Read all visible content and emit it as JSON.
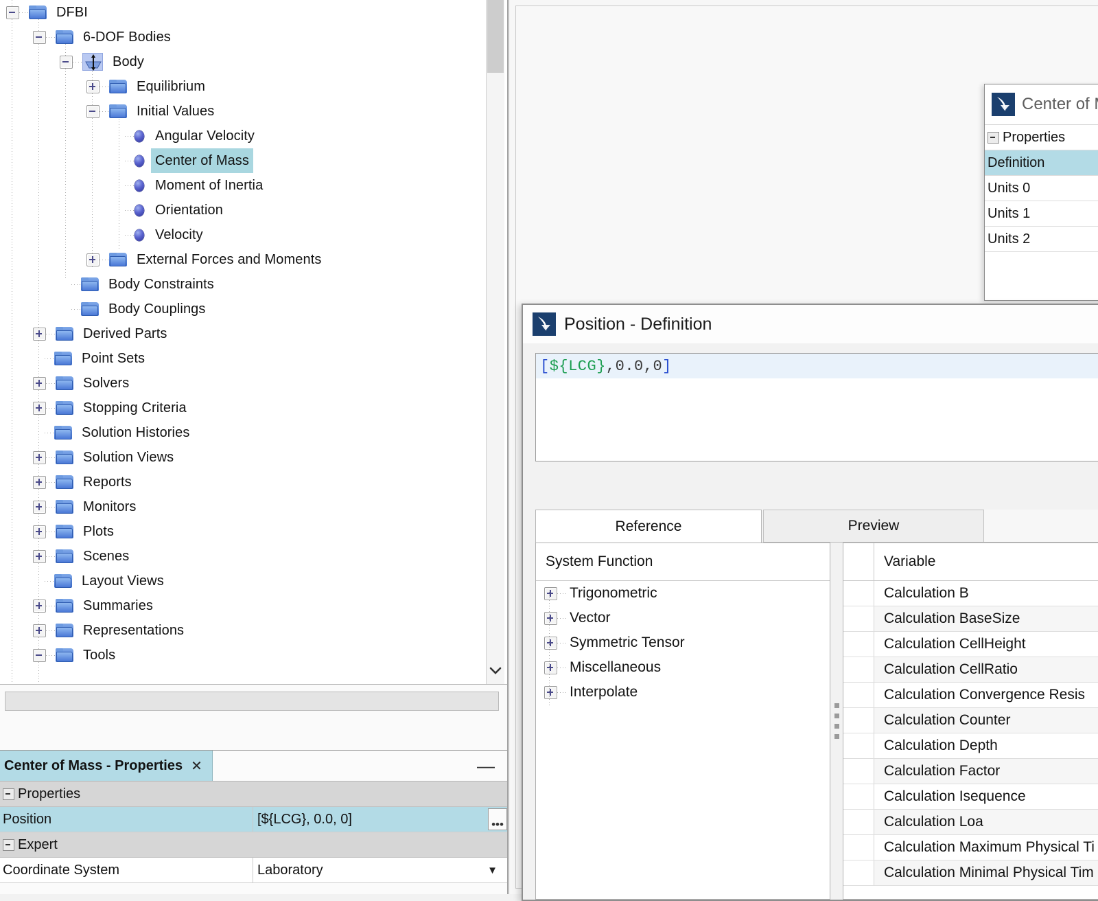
{
  "tree": {
    "nodes": [
      {
        "label": "DFBI",
        "indent": 0,
        "toggle": "minus",
        "icon": "folder"
      },
      {
        "label": "6-DOF Bodies",
        "indent": 1,
        "toggle": "minus",
        "icon": "folder"
      },
      {
        "label": "Body",
        "indent": 2,
        "toggle": "minus",
        "icon": "body"
      },
      {
        "label": "Equilibrium",
        "indent": 3,
        "toggle": "plus",
        "icon": "folder"
      },
      {
        "label": "Initial Values",
        "indent": 3,
        "toggle": "minus",
        "icon": "folder"
      },
      {
        "label": "Angular Velocity",
        "indent": 4,
        "toggle": "leaf",
        "icon": "sphere"
      },
      {
        "label": "Center of Mass",
        "indent": 4,
        "toggle": "leaf",
        "icon": "sphere",
        "selected": true
      },
      {
        "label": "Moment of Inertia",
        "indent": 4,
        "toggle": "leaf",
        "icon": "sphere"
      },
      {
        "label": "Orientation",
        "indent": 4,
        "toggle": "leaf",
        "icon": "sphere"
      },
      {
        "label": "Velocity",
        "indent": 4,
        "toggle": "leaf",
        "icon": "sphere"
      },
      {
        "label": "External Forces and Moments",
        "indent": 3,
        "toggle": "plus",
        "icon": "folder"
      },
      {
        "label": "Body Constraints",
        "indent": 2,
        "toggle": "leaf",
        "icon": "folder"
      },
      {
        "label": "Body Couplings",
        "indent": 2,
        "toggle": "leaf",
        "icon": "folder"
      },
      {
        "label": "Derived Parts",
        "indent": 1,
        "toggle": "plus",
        "icon": "folder"
      },
      {
        "label": "Point Sets",
        "indent": 1,
        "toggle": "leaf",
        "icon": "folder"
      },
      {
        "label": "Solvers",
        "indent": 1,
        "toggle": "plus",
        "icon": "folder"
      },
      {
        "label": "Stopping Criteria",
        "indent": 1,
        "toggle": "plus",
        "icon": "folder"
      },
      {
        "label": "Solution Histories",
        "indent": 1,
        "toggle": "leaf",
        "icon": "folder"
      },
      {
        "label": "Solution Views",
        "indent": 1,
        "toggle": "plus",
        "icon": "folder"
      },
      {
        "label": "Reports",
        "indent": 1,
        "toggle": "plus",
        "icon": "folder"
      },
      {
        "label": "Monitors",
        "indent": 1,
        "toggle": "plus",
        "icon": "folder"
      },
      {
        "label": "Plots",
        "indent": 1,
        "toggle": "plus",
        "icon": "folder"
      },
      {
        "label": "Scenes",
        "indent": 1,
        "toggle": "plus",
        "icon": "folder"
      },
      {
        "label": "Layout Views",
        "indent": 1,
        "toggle": "leaf",
        "icon": "folder"
      },
      {
        "label": "Summaries",
        "indent": 1,
        "toggle": "plus",
        "icon": "folder"
      },
      {
        "label": "Representations",
        "indent": 1,
        "toggle": "plus",
        "icon": "folder"
      },
      {
        "label": "Tools",
        "indent": 1,
        "toggle": "minus",
        "icon": "folder"
      }
    ]
  },
  "properties_panel": {
    "tab_title": "Center of Mass - Properties",
    "close_label": "✕",
    "minimize_label": "—",
    "groups": [
      {
        "name": "Properties",
        "rows": [
          {
            "key": "Position",
            "value": "[${LCG}, 0.0, 0]",
            "highlighted": true,
            "editor": "ellipsis",
            "ellipsis_label": "•••"
          }
        ]
      },
      {
        "name": "Expert",
        "rows": [
          {
            "key": "Coordinate System",
            "value": "Laboratory",
            "highlighted": false,
            "editor": "combo",
            "combo_arrow": "▼"
          }
        ]
      }
    ]
  },
  "com_dialog": {
    "title": "Center of Mass",
    "rows": [
      {
        "label": "Properties",
        "type": "group",
        "toggle": "minus"
      },
      {
        "label": "Definition",
        "type": "row",
        "selected": true
      },
      {
        "label": "Units 0",
        "type": "row"
      },
      {
        "label": "Units 1",
        "type": "row"
      },
      {
        "label": "Units 2",
        "type": "row"
      }
    ]
  },
  "pos_dialog": {
    "title": "Position - Definition",
    "expression": {
      "open_bracket": "[",
      "variable": "${LCG}",
      "after_variable": ", ",
      "value_1": "0.0",
      "separator": ", ",
      "value_2": "0",
      "close_bracket": "]"
    },
    "tabs": [
      {
        "label": "Reference",
        "active": true
      },
      {
        "label": "Preview",
        "active": false
      }
    ],
    "left_pane": {
      "column_header": "System Function",
      "items": [
        {
          "label": "Trigonometric",
          "toggle": "plus"
        },
        {
          "label": "Vector",
          "toggle": "plus"
        },
        {
          "label": "Symmetric Tensor",
          "toggle": "plus"
        },
        {
          "label": "Miscellaneous",
          "toggle": "plus"
        },
        {
          "label": "Interpolate",
          "toggle": "plus"
        }
      ]
    },
    "right_pane": {
      "column_header": "Variable",
      "rows": [
        "Calculation B",
        "Calculation BaseSize",
        "Calculation CellHeight",
        "Calculation CellRatio",
        "Calculation Convergence Resis",
        "Calculation Counter",
        "Calculation Depth",
        "Calculation Factor",
        "Calculation Isequence",
        "Calculation Loa",
        "Calculation Maximum Physical Ti",
        "Calculation Minimal Physical Tim"
      ]
    }
  },
  "scrollbars": {
    "tree_down_arrow": "⌄"
  },
  "colors": {
    "selection": "#a9d7e0",
    "property_highlight": "#b3dbe6",
    "folder_blue": "#4a78d6",
    "expression_variable": "#1d9e52",
    "expression_bracket": "#2a4fd0",
    "app_icon_navy": "#1b3f6e"
  }
}
